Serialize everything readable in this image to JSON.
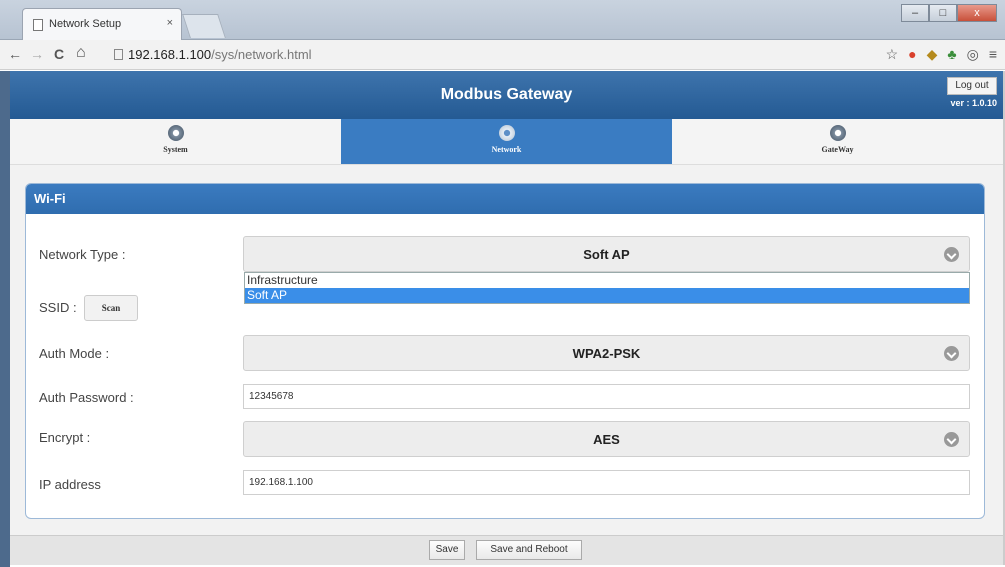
{
  "browser": {
    "tab_title": "Network Setup",
    "tab_close": "×",
    "url_host": "192.168.1.100",
    "url_path": "/sys/network.html",
    "back": "←",
    "forward": "→",
    "reload": "C",
    "home": "⌂"
  },
  "window_controls": {
    "minimize": "–",
    "maximize": "□",
    "close": "x"
  },
  "toolbar_icons": [
    "☆",
    "●",
    "◆",
    "♣",
    "◎",
    "≡"
  ],
  "header": {
    "title": "Modbus Gateway",
    "logout": "Log out",
    "version": "ver : 1.0.10"
  },
  "nav": {
    "tabs": [
      {
        "label": "System",
        "active": false
      },
      {
        "label": "Network",
        "active": true
      },
      {
        "label": "GateWay",
        "active": false
      }
    ]
  },
  "panel": {
    "title": "Wi-Fi"
  },
  "form": {
    "network_type_label": "Network Type :",
    "network_type_value": "Soft AP",
    "network_type_options": [
      "Infrastructure",
      "Soft AP"
    ],
    "ssid_label": "SSID :",
    "scan_label": "Scan",
    "auth_mode_label": "Auth Mode :",
    "auth_mode_value": "WPA2-PSK",
    "auth_password_label": "Auth Password :",
    "auth_password_value": "12345678",
    "encrypt_label": "Encrypt :",
    "encrypt_value": "AES",
    "ip_label": "IP address",
    "ip_value": "192.168.1.100"
  },
  "actions": {
    "save": "Save",
    "save_reboot": "Save and Reboot"
  },
  "colors": {
    "header_blue": "#2f6daf",
    "active_tab": "#3a7cc2",
    "selected_option": "#3a8ee8"
  }
}
